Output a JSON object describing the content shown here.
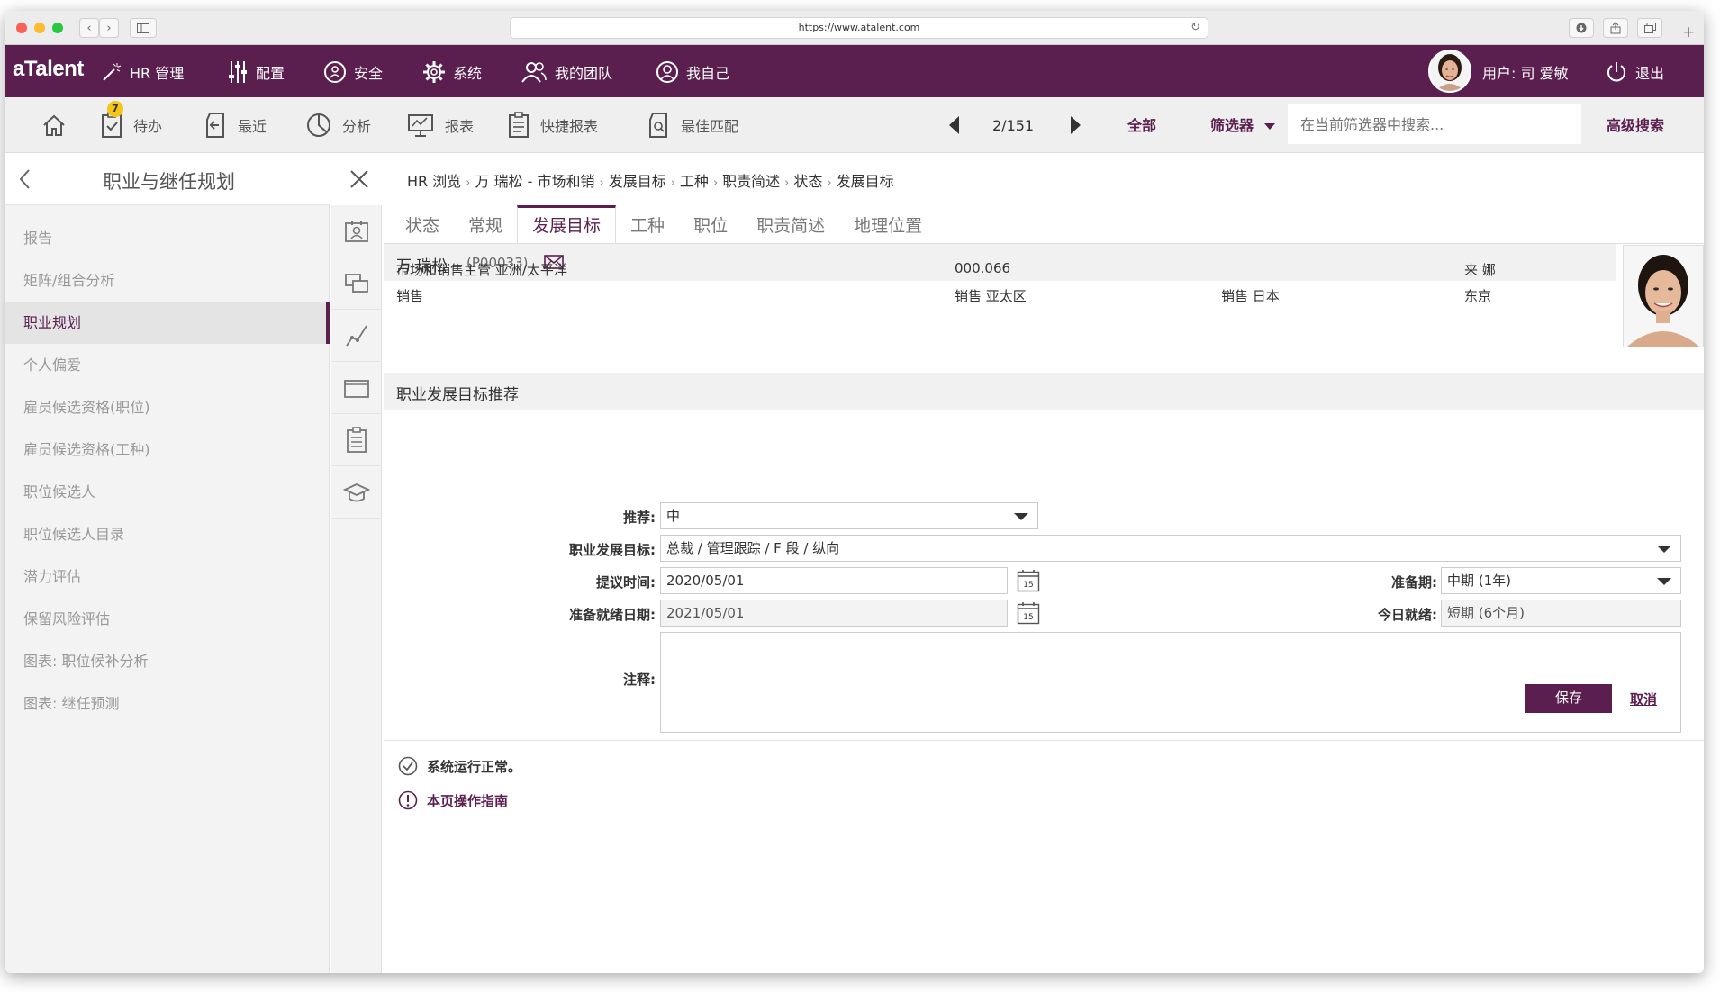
{
  "browser": {
    "url": "https://www.atalent.com"
  },
  "topnav": {
    "logo": "aTalent",
    "items": [
      "HR 管理",
      "配置",
      "安全",
      "系统",
      "我的团队",
      "我自己"
    ],
    "user_label": "用户: 司 爱敏",
    "logout": "退出"
  },
  "toolbar": {
    "home": "",
    "todo": "待办",
    "todo_badge": "7",
    "recent": "最近",
    "analysis": "分析",
    "reports": "报表",
    "quick_reports": "快捷报表",
    "best_match": "最佳匹配",
    "pager": "2/151",
    "all": "全部",
    "filter": "筛选器",
    "search_placeholder": "在当前筛选器中搜索...",
    "advanced_search": "高级搜索"
  },
  "sidebar": {
    "title": "职业与继任规划",
    "items": [
      "报告",
      "矩阵/组合分析",
      "职业规划",
      "个人偏爱",
      "雇员候选资格(职位)",
      "雇员候选资格(工种)",
      "职位候选人",
      "职位候选人目录",
      "潜力评估",
      "保留风险评估",
      "图表: 职位候补分析",
      "图表: 继任预测"
    ],
    "active_index": 2
  },
  "breadcrumb": [
    "HR 浏览",
    "万 瑞松 - 市场和销",
    "发展目标",
    "工种",
    "职责简述",
    "状态",
    "发展目标"
  ],
  "tabs": [
    "状态",
    "常规",
    "发展目标",
    "工种",
    "职位",
    "职责简述",
    "地理位置"
  ],
  "active_tab": 2,
  "employee": {
    "name": "万 瑞松",
    "id": "(P00033)",
    "row1": [
      "市场和销售主管 亚洲/太平洋",
      "000.066",
      "来 娜"
    ],
    "row2": [
      "销售",
      "销售 亚太区",
      "销售 日本",
      "东京"
    ]
  },
  "section_title": "职业发展目标推荐",
  "form": {
    "recommend_label": "推荐:",
    "recommend_value": "中",
    "goal_label": "职业发展目标:",
    "goal_value": "总裁 / 管理跟踪 / F 段 / 纵向",
    "proposed_label": "提议时间:",
    "proposed_value": "2020/05/01",
    "prep_label": "准备期:",
    "prep_value": "中期 (1年)",
    "ready_date_label": "准备就绪日期:",
    "ready_date_value": "2021/05/01",
    "ready_today_label": "今日就绪:",
    "ready_today_value": "短期 (6个月)",
    "notes_label": "注释:",
    "notes_value": "",
    "calendar_day": "15",
    "save": "保存",
    "cancel": "取消"
  },
  "status": {
    "ok": "系统运行正常。",
    "guide": "本页操作指南"
  },
  "colors": {
    "brand": "#5a1f4f",
    "badge": "#f5c518"
  }
}
